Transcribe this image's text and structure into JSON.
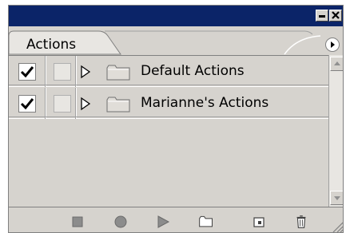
{
  "panel": {
    "tab_label": "Actions",
    "rows": [
      {
        "label": "Default Actions",
        "checked": true
      },
      {
        "label": "Marianne's Actions",
        "checked": true
      }
    ]
  },
  "icons": {
    "minimize": "minimize-icon",
    "close": "close-icon",
    "panel_menu": "panel-menu-arrow-icon",
    "expand": "expand-triangle-icon",
    "folder": "folder-icon",
    "stop": "stop-icon",
    "record": "record-icon",
    "play": "play-icon",
    "new_set": "new-set-icon",
    "new_action": "new-action-icon",
    "delete": "trash-icon"
  },
  "colors": {
    "titlebar": "#0b2468",
    "panel_bg": "#d6d3ce"
  }
}
